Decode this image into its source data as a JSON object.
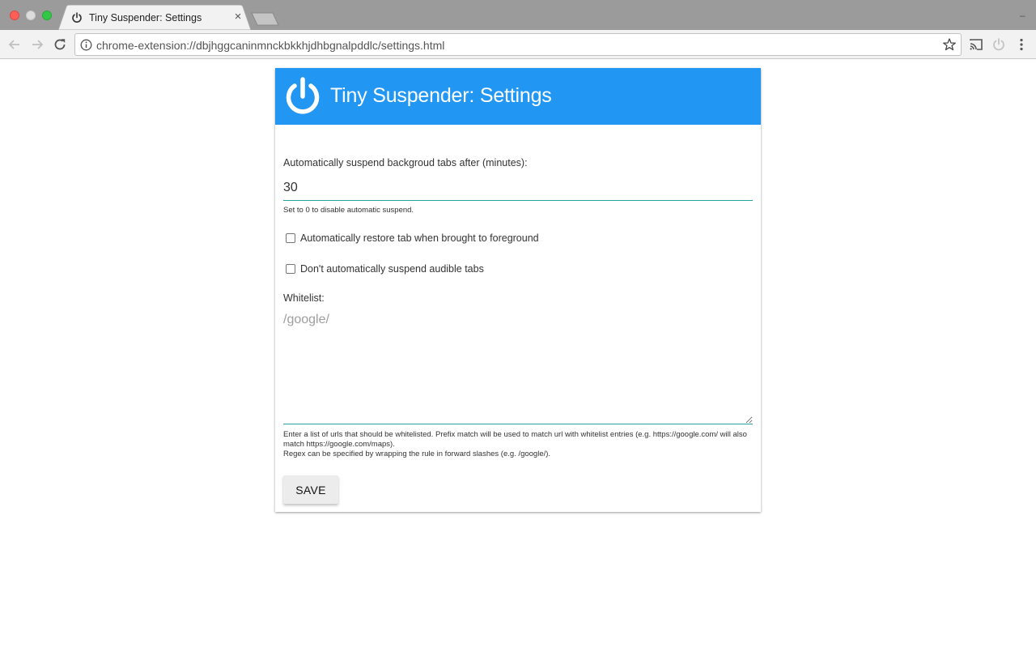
{
  "browser": {
    "tab_title": "Tiny Suspender: Settings",
    "tab_close": "×",
    "url": "chrome-extension://dbjhggcaninmnckbkkhjdhbgnalpddlc/settings.html"
  },
  "header": {
    "title": "Tiny Suspender: Settings",
    "color": "#2196f3"
  },
  "settings": {
    "suspend_label": "Automatically suspend backgroud tabs after (minutes):",
    "suspend_minutes": "30",
    "suspend_hint": "Set to 0 to disable automatic suspend.",
    "restore_label": "Automatically restore tab when brought to foreground",
    "restore_checked": false,
    "audible_label": "Don't automatically suspend audible tabs",
    "audible_checked": false,
    "whitelist_label": "Whitelist:",
    "whitelist_placeholder": "/google/",
    "whitelist_hint_1": "Enter a list of urls that should be whitelisted. Prefix match will be used to match url with whitelist entries (e.g. https://google.com/ will also match https://google.com/maps).",
    "whitelist_hint_2": "Regex can be specified by wrapping the rule in forward slashes (e.g. /google/).",
    "save_label": "SAVE"
  },
  "colors": {
    "accent_teal": "#26a69a"
  }
}
